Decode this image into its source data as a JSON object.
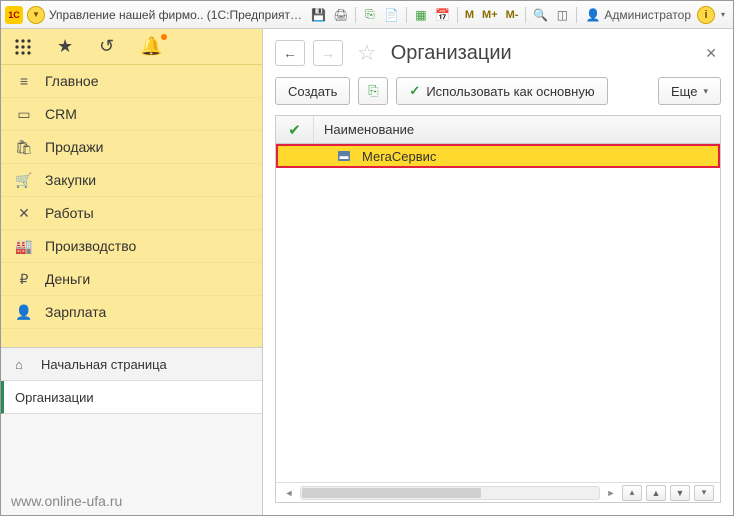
{
  "titlebar": {
    "app_title": "Управление нашей фирмо.. (1С:Предприятие)",
    "user_label": "Администратор",
    "m_buttons": [
      "M",
      "M+",
      "M-"
    ]
  },
  "sidebar": {
    "items": [
      {
        "icon": "list-icon",
        "label": "Главное"
      },
      {
        "icon": "card-icon",
        "label": "CRM"
      },
      {
        "icon": "basket-icon",
        "label": "Продажи"
      },
      {
        "icon": "cart-icon",
        "label": "Закупки"
      },
      {
        "icon": "tools-icon",
        "label": "Работы"
      },
      {
        "icon": "factory-icon",
        "label": "Производство"
      },
      {
        "icon": "ruble-icon",
        "label": "Деньги"
      },
      {
        "icon": "person-icon",
        "label": "Зарплата"
      }
    ],
    "tabs": [
      {
        "icon": "home-icon",
        "label": "Начальная страница",
        "active": false
      },
      {
        "icon": "",
        "label": "Организации",
        "active": true
      }
    ]
  },
  "main": {
    "title": "Организации",
    "create_label": "Создать",
    "use_main_label": "Использовать как основную",
    "more_label": "Еще",
    "grid": {
      "col_check": "✓",
      "col_name": "Наименование",
      "rows": [
        {
          "name": "МегаСервис"
        }
      ]
    }
  },
  "footer": {
    "url": "www.online-ufa.ru"
  }
}
